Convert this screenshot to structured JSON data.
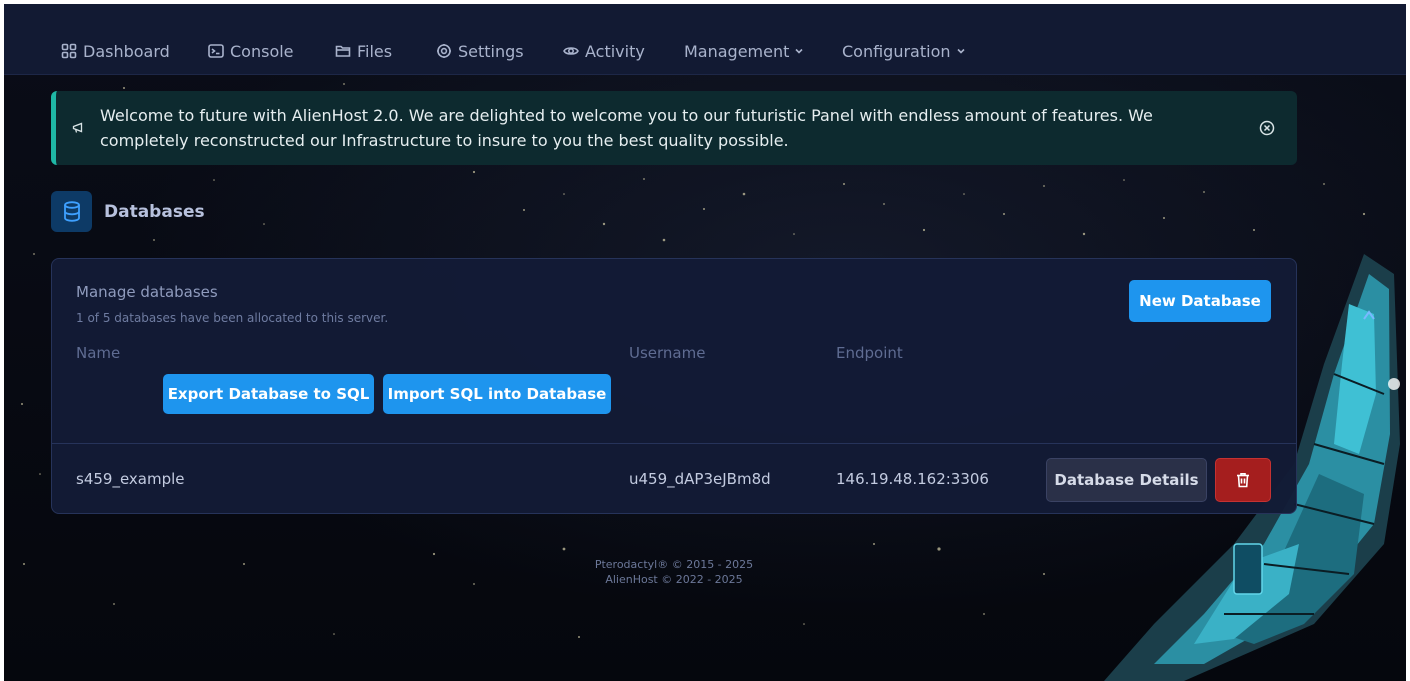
{
  "nav": {
    "items": [
      {
        "label": "Dashboard",
        "icon": "grid-icon"
      },
      {
        "label": "Console",
        "icon": "terminal-icon"
      },
      {
        "label": "Files",
        "icon": "folder-icon"
      },
      {
        "label": "Settings",
        "icon": "gear-icon"
      },
      {
        "label": "Activity",
        "icon": "eye-icon"
      },
      {
        "label": "Management",
        "icon": "chevron-down-icon"
      },
      {
        "label": "Configuration",
        "icon": "chevron-down-icon"
      }
    ]
  },
  "alert": {
    "icon": "megaphone-icon",
    "text": "Welcome to future with AlienHost 2.0. We are delighted to welcome you to our futuristic Panel with endless amount of features. We completely reconstructed our Infrastructure to insure to you the best quality possible.",
    "close_icon": "close-circle-icon",
    "accent_color": "#1fb8a6"
  },
  "page": {
    "title": "Databases",
    "icon": "database-icon"
  },
  "card": {
    "title": "Manage databases",
    "subtitle": "1 of 5 databases have been allocated to this server.",
    "new_button": "New Database",
    "export_button": "Export Database to SQL",
    "import_button": "Import SQL into Database",
    "columns": {
      "name": "Name",
      "username": "Username",
      "endpoint": "Endpoint"
    },
    "rows": [
      {
        "name": "s459_example",
        "username": "u459_dAP3eJBm8d",
        "endpoint": "146.19.48.162:3306",
        "details_button": "Database Details",
        "delete_icon": "trash-icon"
      }
    ]
  },
  "footer": {
    "line1": "Pterodactyl® © 2015 - 2025",
    "line2": "AlienHost © 2022 - 2025"
  },
  "colors": {
    "primary": "#1e95ee",
    "danger": "#a51e1e",
    "navbar": "#121a33",
    "card": "#131b36"
  }
}
